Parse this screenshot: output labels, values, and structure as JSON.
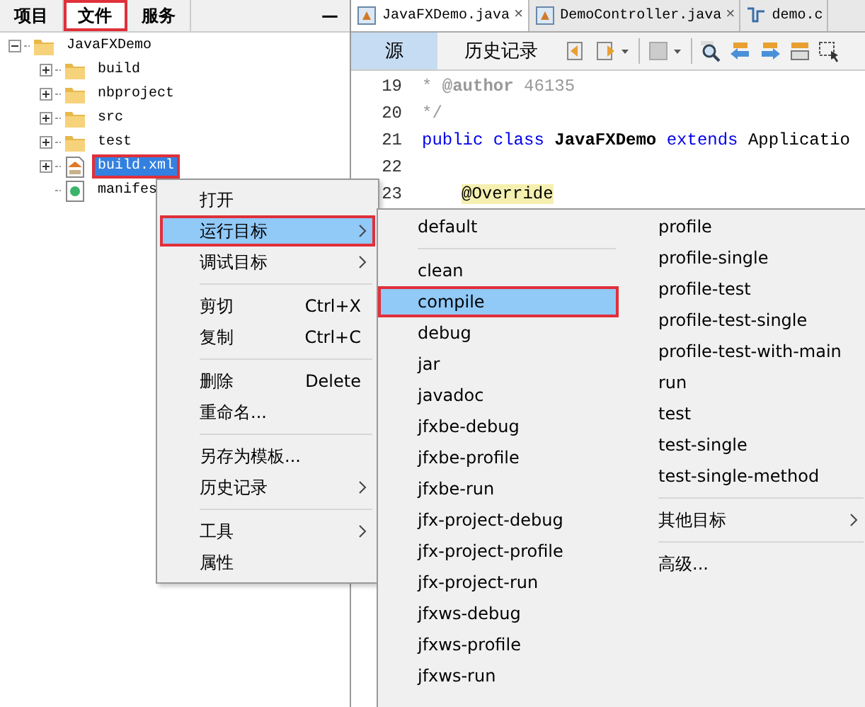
{
  "left_panel": {
    "tabs": [
      {
        "label": "项目",
        "selected": false,
        "highlighted": false
      },
      {
        "label": "文件",
        "selected": true,
        "highlighted": true
      },
      {
        "label": "服务",
        "selected": false,
        "highlighted": false
      }
    ],
    "minimize": "—",
    "tree": [
      {
        "label": "JavaFXDemo",
        "kind": "folder",
        "expanded": true,
        "selected": false,
        "highlighted": false,
        "children": [
          {
            "label": "build",
            "kind": "folder",
            "expanded": false,
            "selected": false,
            "highlighted": false
          },
          {
            "label": "nbproject",
            "kind": "folder",
            "expanded": false,
            "selected": false,
            "highlighted": false
          },
          {
            "label": "src",
            "kind": "folder",
            "expanded": false,
            "selected": false,
            "highlighted": false
          },
          {
            "label": "test",
            "kind": "folder",
            "expanded": false,
            "selected": false,
            "highlighted": false
          },
          {
            "label": "build.xml",
            "kind": "xml",
            "expanded": false,
            "selected": true,
            "highlighted": true
          },
          {
            "label": "manifes",
            "kind": "manifest",
            "selected": false,
            "highlighted": false
          }
        ]
      }
    ]
  },
  "editor": {
    "tabs": [
      {
        "label": "JavaFXDemo.java",
        "close": "×",
        "kind": "java",
        "selected": true
      },
      {
        "label": "DemoController.java",
        "close": "×",
        "kind": "java",
        "selected": false
      },
      {
        "label": "demo.c",
        "kind": "fxml",
        "selected": false
      }
    ],
    "view_tabs": [
      {
        "label": "源",
        "selected": true
      },
      {
        "label": "历史记录",
        "selected": false
      }
    ],
    "toolbar": [
      {
        "kind": "back"
      },
      {
        "kind": "forward-dropdown"
      },
      {
        "kind": "disabled-dropdown"
      },
      {
        "kind": "separator"
      },
      {
        "kind": "search"
      },
      {
        "kind": "prev"
      },
      {
        "kind": "next"
      },
      {
        "kind": "toggle"
      },
      {
        "kind": "select"
      }
    ],
    "lines": [
      {
        "number": "19",
        "tokens": [
          {
            "kind": "comment",
            "text": "* "
          },
          {
            "kind": "doctag",
            "text": "@author"
          },
          {
            "kind": "comment",
            "text": " 46135"
          }
        ]
      },
      {
        "number": "20",
        "tokens": [
          {
            "kind": "comment",
            "text": "*/"
          }
        ]
      },
      {
        "number": "21",
        "tokens": [
          {
            "kind": "keyword",
            "text": "public class "
          },
          {
            "kind": "bold",
            "text": "JavaFXDemo"
          },
          {
            "kind": "keyword",
            "text": " extends "
          },
          {
            "kind": "plain",
            "text": "Applicatio"
          }
        ]
      },
      {
        "number": "22"
      },
      {
        "number": "23",
        "tokens": [
          {
            "kind": "annotation",
            "text": "@Override"
          }
        ]
      }
    ]
  },
  "context_menu": [
    {
      "kind": "item",
      "label": "打开",
      "selected": false,
      "highlighted": false,
      "submenu": false
    },
    {
      "kind": "item",
      "label": "运行目标",
      "selected": true,
      "highlighted": true,
      "submenu": true
    },
    {
      "kind": "item",
      "label": "调试目标",
      "selected": false,
      "highlighted": false,
      "submenu": true
    },
    {
      "kind": "separator"
    },
    {
      "kind": "item",
      "label": "剪切",
      "shortcut": "Ctrl+X",
      "selected": false,
      "highlighted": false,
      "submenu": false
    },
    {
      "kind": "item",
      "label": "复制",
      "shortcut": "Ctrl+C",
      "selected": false,
      "highlighted": false,
      "submenu": false
    },
    {
      "kind": "separator"
    },
    {
      "kind": "item",
      "label": "删除",
      "shortcut": "Delete",
      "selected": false,
      "highlighted": false,
      "submenu": false
    },
    {
      "kind": "item",
      "label": "重命名...",
      "selected": false,
      "highlighted": false,
      "submenu": false
    },
    {
      "kind": "separator"
    },
    {
      "kind": "item",
      "label": "另存为模板...",
      "selected": false,
      "highlighted": false,
      "submenu": false
    },
    {
      "kind": "item",
      "label": "历史记录",
      "selected": false,
      "highlighted": false,
      "submenu": true
    },
    {
      "kind": "separator"
    },
    {
      "kind": "item",
      "label": "工具",
      "selected": false,
      "highlighted": false,
      "submenu": true
    },
    {
      "kind": "item",
      "label": "属性",
      "selected": false,
      "highlighted": false,
      "submenu": false
    }
  ],
  "run_target_menu": {
    "column_1": [
      {
        "kind": "item",
        "label": "default",
        "selected": false,
        "highlighted": false
      },
      {
        "kind": "separator"
      },
      {
        "kind": "item",
        "label": "clean",
        "selected": false,
        "highlighted": false
      },
      {
        "kind": "item",
        "label": "compile",
        "selected": true,
        "highlighted": true
      },
      {
        "kind": "item",
        "label": "debug",
        "selected": false,
        "highlighted": false
      },
      {
        "kind": "item",
        "label": "jar",
        "selected": false,
        "highlighted": false
      },
      {
        "kind": "item",
        "label": "javadoc",
        "selected": false,
        "highlighted": false
      },
      {
        "kind": "item",
        "label": "jfxbe-debug",
        "selected": false,
        "highlighted": false
      },
      {
        "kind": "item",
        "label": "jfxbe-profile",
        "selected": false,
        "highlighted": false
      },
      {
        "kind": "item",
        "label": "jfxbe-run",
        "selected": false,
        "highlighted": false
      },
      {
        "kind": "item",
        "label": "jfx-project-debug",
        "selected": false,
        "highlighted": false
      },
      {
        "kind": "item",
        "label": "jfx-project-profile",
        "selected": false,
        "highlighted": false
      },
      {
        "kind": "item",
        "label": "jfx-project-run",
        "selected": false,
        "highlighted": false
      },
      {
        "kind": "item",
        "label": "jfxws-debug",
        "selected": false,
        "highlighted": false
      },
      {
        "kind": "item",
        "label": "jfxws-profile",
        "selected": false,
        "highlighted": false
      },
      {
        "kind": "item",
        "label": "jfxws-run",
        "selected": false,
        "highlighted": false
      }
    ],
    "column_2": [
      {
        "kind": "item",
        "label": "profile",
        "selected": false,
        "highlighted": false
      },
      {
        "kind": "item",
        "label": "profile-single",
        "selected": false,
        "highlighted": false
      },
      {
        "kind": "item",
        "label": "profile-test",
        "selected": false,
        "highlighted": false
      },
      {
        "kind": "item",
        "label": "profile-test-single",
        "selected": false,
        "highlighted": false
      },
      {
        "kind": "item",
        "label": "profile-test-with-main",
        "selected": false,
        "highlighted": false
      },
      {
        "kind": "item",
        "label": "run",
        "selected": false,
        "highlighted": false
      },
      {
        "kind": "item",
        "label": "test",
        "selected": false,
        "highlighted": false
      },
      {
        "kind": "item",
        "label": "test-single",
        "selected": false,
        "highlighted": false
      },
      {
        "kind": "item",
        "label": "test-single-method",
        "selected": false,
        "highlighted": false
      },
      {
        "kind": "separator"
      },
      {
        "kind": "item",
        "label": "其他目标",
        "selected": false,
        "highlighted": false,
        "submenu": true
      },
      {
        "kind": "separator"
      },
      {
        "kind": "item",
        "label": "高级...",
        "selected": false,
        "highlighted": false
      }
    ]
  }
}
